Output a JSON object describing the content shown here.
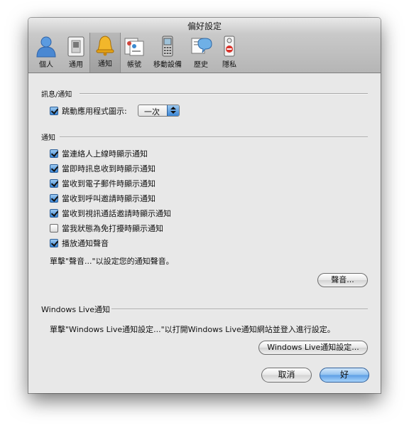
{
  "window": {
    "title": "偏好設定"
  },
  "toolbar": [
    {
      "label": "個人",
      "icon": "person-icon"
    },
    {
      "label": "通用",
      "icon": "switch-icon"
    },
    {
      "label": "通知",
      "icon": "bell-icon"
    },
    {
      "label": "帳號",
      "icon": "accounts-icon"
    },
    {
      "label": "移動設備",
      "icon": "mobile-phone-icon"
    },
    {
      "label": "歷史",
      "icon": "history-icon"
    },
    {
      "label": "隱私",
      "icon": "privacy-sign-icon"
    }
  ],
  "selected_tab": "通知",
  "alerts_section": {
    "header": "訊息/通知",
    "bounce_checkbox": {
      "label": "跳動應用程式圖示:",
      "checked": true
    },
    "bounce_select": {
      "value": "一次"
    }
  },
  "notify_section": {
    "header": "通知",
    "options": [
      {
        "label": "當連絡人上線時顯示通知",
        "checked": true
      },
      {
        "label": "當即時訊息收到時顯示通知",
        "checked": true
      },
      {
        "label": "當收到電子郵件時顯示通知",
        "checked": true
      },
      {
        "label": "當收到呼叫邀請時顯示通知",
        "checked": true
      },
      {
        "label": "當收到視訊通話邀請時顯示通知",
        "checked": true
      },
      {
        "label": "當我狀態為免打擾時顯示通知",
        "checked": false
      },
      {
        "label": "播放通知聲音",
        "checked": true
      }
    ],
    "sound_hint": "單擊\"聲音...\"以設定您的通知聲音。",
    "sound_button": "聲音..."
  },
  "live_section": {
    "header": "Windows Live通知",
    "hint": "單擊\"Windows Live通知設定...\"以打開Windows Live通知網站並登入進行設定。",
    "button": "Windows Live通知設定..."
  },
  "footer": {
    "cancel": "取消",
    "ok": "好"
  },
  "colors": {
    "accent": "#3a86d6",
    "window_bg": "#e8e8e8"
  }
}
